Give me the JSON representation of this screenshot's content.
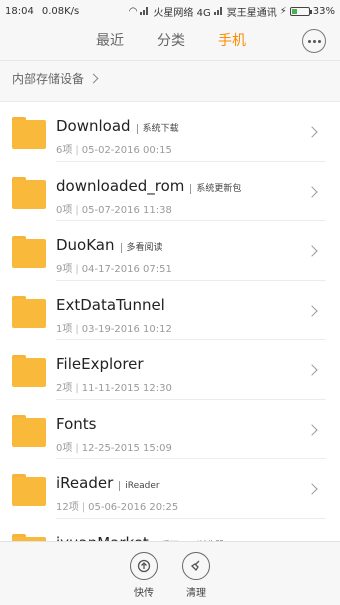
{
  "status_bar": {
    "time": "18:04",
    "speed": "0.08K/s",
    "carrier1": "火星网络 4G",
    "carrier2": "冥王星通讯",
    "battery": "33%",
    "battery_level": 0.33
  },
  "tabs": [
    {
      "label": "最近"
    },
    {
      "label": "分类"
    },
    {
      "label": "手机",
      "active": true
    }
  ],
  "breadcrumb": {
    "label": "内部存储设备"
  },
  "files": [
    {
      "name": "Download",
      "desc": "系统下载",
      "count": "6项",
      "date": "05-02-2016 00:15"
    },
    {
      "name": "downloaded_rom",
      "desc": "系统更新包",
      "count": "0项",
      "date": "05-07-2016 11:38"
    },
    {
      "name": "DuoKan",
      "desc": "多看阅读",
      "count": "9项",
      "date": "04-17-2016 07:51"
    },
    {
      "name": "ExtDataTunnel",
      "desc": "",
      "count": "1项",
      "date": "03-19-2016 10:12"
    },
    {
      "name": "FileExplorer",
      "desc": "",
      "count": "2项",
      "date": "11-11-2015 12:30"
    },
    {
      "name": "Fonts",
      "desc": "",
      "count": "0项",
      "date": "12-25-2015 15:09"
    },
    {
      "name": "iReader",
      "desc": "iReader",
      "count": "12项",
      "date": "05-06-2016 20:25"
    },
    {
      "name": "iyuanMarket",
      "desc": "爱玩WiFi浏览器",
      "count": "",
      "date": ""
    }
  ],
  "bottom_bar": {
    "share_label": "快传",
    "clean_label": "清理"
  },
  "colors": {
    "accent": "#ff8a00",
    "folder": "#f9b93b"
  }
}
